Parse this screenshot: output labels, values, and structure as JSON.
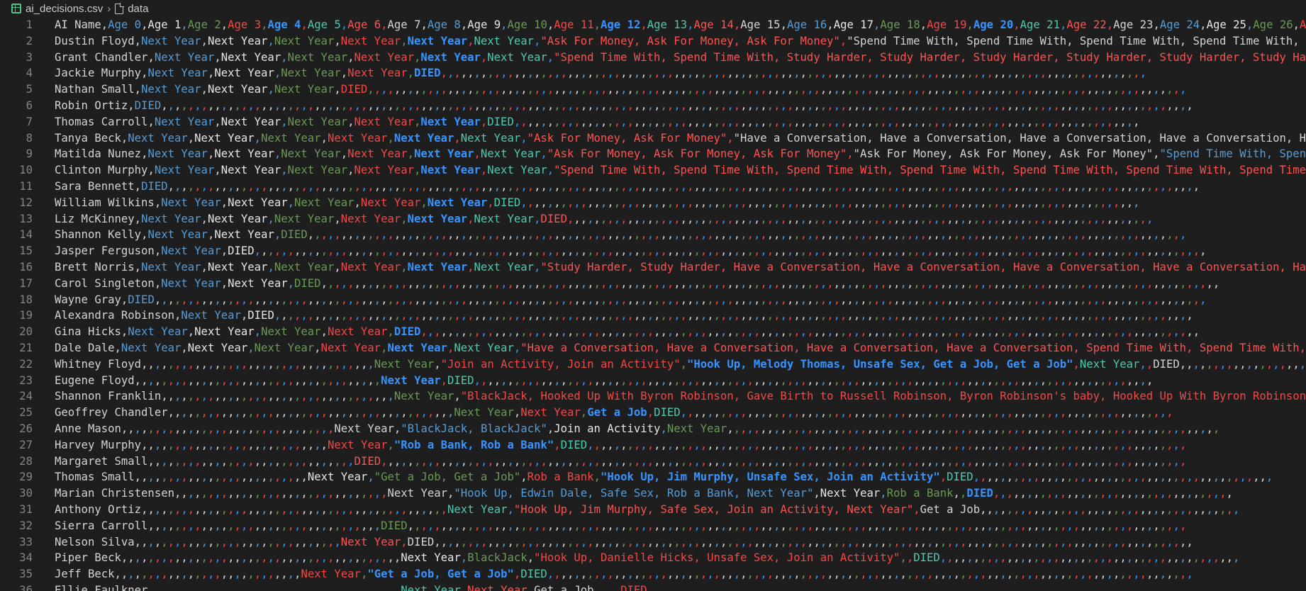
{
  "breadcrumb": {
    "file": "ai_decisions.csv",
    "section": "data"
  },
  "lines": [
    {
      "n": "1",
      "text": "AI Name,Age 0,Age 1,Age 2,Age 3,Age 4,Age 5,Age 6,Age 7,Age 8,Age 9,Age 10,Age 11,Age 12,Age 13,Age 14,Age 15,Age 16,Age 17,Age 18,Age 19,Age 20,Age 21,Age 22,Age 23,Age 24,Age 25,Age 26,Age"
    },
    {
      "n": "2",
      "text": "Dustin Floyd,Next Year,Next Year,Next Year,Next Year,Next Year,Next Year,\"Ask For Money, Ask For Money, Ask For Money\",\"Spend Time With, Spend Time With, Spend Time With, Spend Time With, Spe"
    },
    {
      "n": "3",
      "text": "Grant Chandler,Next Year,Next Year,Next Year,Next Year,Next Year,Next Year,\"Spend Time With, Spend Time With, Study Harder, Study Harder, Study Harder, Study Harder, Study Harder, Study Harde"
    },
    {
      "n": "4",
      "text": "Jackie Murphy,Next Year,Next Year,Next Year,Next Year,DIED,,,,,,,,,,,,,,,,,,,,,,,,,,,,,,,,,,,,,,,,,,,,,,,,,,,,,,,,,,,,,,,,,,,,,,,,,,,,,,,,,,,,,,,,,,,,,,,,,,,,,,,,,,"
    },
    {
      "n": "5",
      "text": "Nathan Small,Next Year,Next Year,Next Year,DIED,,,,,,,,,,,,,,,,,,,,,,,,,,,,,,,,,,,,,,,,,,,,,,,,,,,,,,,,,,,,,,,,,,,,,,,,,,,,,,,,,,,,,,,,,,,,,,,,,,,,,,,,,,,,,,,,,,,,,,,,,,,"
    },
    {
      "n": "6",
      "text": "Robin Ortiz,DIED,,,,,,,,,,,,,,,,,,,,,,,,,,,,,,,,,,,,,,,,,,,,,,,,,,,,,,,,,,,,,,,,,,,,,,,,,,,,,,,,,,,,,,,,,,,,,,,,,,,,,,,,,,,,,,,,,,,,,,,,,,,,,,,,,,,,,,,,,,,,,,,,,,,,,,,,,,,"
    },
    {
      "n": "7",
      "text": "Thomas Carroll,Next Year,Next Year,Next Year,Next Year,Next Year,DIED,,,,,,,,,,,,,,,,,,,,,,,,,,,,,,,,,,,,,,,,,,,,,,,,,,,,,,,,,,,,,,,,,,,,,,,,,,,,,,,,,,,,,,,,,,,,,,"
    },
    {
      "n": "8",
      "text": "Tanya Beck,Next Year,Next Year,Next Year,Next Year,Next Year,Next Year,\"Ask For Money, Ask For Money\",\"Have a Conversation, Have a Conversation, Have a Conversation, Have a Conversation, Have"
    },
    {
      "n": "9",
      "text": "Matilda Nunez,Next Year,Next Year,Next Year,Next Year,Next Year,Next Year,\"Ask For Money, Ask For Money, Ask For Money\",\"Ask For Money, Ask For Money, Ask For Money\",\"Spend Time With, Spend T"
    },
    {
      "n": "10",
      "text": "Clinton Murphy,Next Year,Next Year,Next Year,Next Year,Next Year,Next Year,\"Spend Time With, Spend Time With, Spend Time With, Spend Time With, Spend Time With, Spend Time With, Spend Time Wit"
    },
    {
      "n": "11",
      "text": "Sara Bennett,DIED,,,,,,,,,,,,,,,,,,,,,,,,,,,,,,,,,,,,,,,,,,,,,,,,,,,,,,,,,,,,,,,,,,,,,,,,,,,,,,,,,,,,,,,,,,,,,,,,,,,,,,,,,,,,,,,,,,,,,,,,,,,,,,,,,,,,,,,,,,,,,,,,,,,,,,,,,,,"
    },
    {
      "n": "12",
      "text": "William Wilkins,Next Year,Next Year,Next Year,Next Year,Next Year,DIED,,,,,,,,,,,,,,,,,,,,,,,,,,,,,,,,,,,,,,,,,,,,,,,,,,,,,,,,,,,,,,,,,,,,,,,,,,,,,,,,,,,,,,,,,,,,,"
    },
    {
      "n": "13",
      "text": "Liz McKinney,Next Year,Next Year,Next Year,Next Year,Next Year,Next Year,DIED,,,,,,,,,,,,,,,,,,,,,,,,,,,,,,,,,,,,,,,,,,,,,,,,,,,,,,,,,,,,,,,,,,,,,,,,,,,,,,,,,,,,,,,,"
    },
    {
      "n": "14",
      "text": "Shannon Kelly,Next Year,Next Year,DIED,,,,,,,,,,,,,,,,,,,,,,,,,,,,,,,,,,,,,,,,,,,,,,,,,,,,,,,,,,,,,,,,,,,,,,,,,,,,,,,,,,,,,,,,,,,,,,,,,,,,,,,,,,,,,,,,,,,,,,,,,,,,,,,,,,,,"
    },
    {
      "n": "15",
      "text": "Jasper Ferguson,Next Year,DIED,,,,,,,,,,,,,,,,,,,,,,,,,,,,,,,,,,,,,,,,,,,,,,,,,,,,,,,,,,,,,,,,,,,,,,,,,,,,,,,,,,,,,,,,,,,,,,,,,,,,,,,,,,,,,,,,,,,,,,,,,,,,,,,,,,,,,,,,,,,,,,,"
    },
    {
      "n": "16",
      "text": "Brett Norris,Next Year,Next Year,Next Year,Next Year,Next Year,Next Year,\"Study Harder, Study Harder, Have a Conversation, Have a Conversation, Have a Conversation, Have a Conversation, Have"
    },
    {
      "n": "17",
      "text": "Carol Singleton,Next Year,Next Year,DIED,,,,,,,,,,,,,,,,,,,,,,,,,,,,,,,,,,,,,,,,,,,,,,,,,,,,,,,,,,,,,,,,,,,,,,,,,,,,,,,,,,,,,,,,,,,,,,,,,,,,,,,,,,,,,,,,,,,,,,,,,,,,,,,,,,,,,,,"
    },
    {
      "n": "18",
      "text": "Wayne Gray,DIED,,,,,,,,,,,,,,,,,,,,,,,,,,,,,,,,,,,,,,,,,,,,,,,,,,,,,,,,,,,,,,,,,,,,,,,,,,,,,,,,,,,,,,,,,,,,,,,,,,,,,,,,,,,,,,,,,,,,,,,,,,,,,,,,,,,,,,,,,,,,,,,,,,,,,,,,,,,,,,"
    },
    {
      "n": "19",
      "text": "Alexandra Robinson,Next Year,DIED,,,,,,,,,,,,,,,,,,,,,,,,,,,,,,,,,,,,,,,,,,,,,,,,,,,,,,,,,,,,,,,,,,,,,,,,,,,,,,,,,,,,,,,,,,,,,,,,,,,,,,,,,,,,,,,,,,,,,,,,,,,,,,,,,,,,,,,,,,"
    },
    {
      "n": "20",
      "text": "Gina Hicks,Next Year,Next Year,Next Year,Next Year,DIED,,,,,,,,,,,,,,,,,,,,,,,,,,,,,,,,,,,,,,,,,,,,,,,,,,,,,,,,,,,,,,,,,,,,,,,,,,,,,,,,,,,,,,,,,,,,,,,,,,,,,,,,,,,,,,,,,,,,,"
    },
    {
      "n": "21",
      "text": "Dale Dale,Next Year,Next Year,Next Year,Next Year,Next Year,Next Year,\"Have a Conversation, Have a Conversation, Have a Conversation, Have a Conversation, Spend Time With, Spend Time With, Sp"
    },
    {
      "n": "22",
      "text": "Whitney Floyd,,,,,,,,,,,,,,,,,,,,,,,,,,,,,,,,,,,Next Year,\"Join an Activity, Join an Activity\",\"Hook Up, Melody Thomas, Unsafe Sex, Get a Job, Get a Job\",Next Year,,DIED,,,,,,,,,,,,,,,,,,,,,,,,,"
    },
    {
      "n": "23",
      "text": "Eugene Floyd,,,,,,,,,,,,,,,,,,,,,,,,,,,,,,,,,,,,,Next Year,DIED,,,,,,,,,,,,,,,,,,,,,,,,,,,,,,,,,,,,,,,,,,,,,,,,,,,,,,,,,,,,,,,,,,,,,,,,,,,,,,,,,,,,,,,,,,,,,,,,,,,,,,"
    },
    {
      "n": "24",
      "text": "Shannon Franklin,,,,,,,,,,,,,,,,,,,,,,,,,,,,,,,,,,,Next Year,\"BlackJack, Hooked Up With Byron Robinson, Gave Birth to Russell Robinson, Byron Robinson's baby, Hooked Up With Byron Robinson\",DI"
    },
    {
      "n": "25",
      "text": "Geoffrey Chandler,,,,,,,,,,,,,,,,,,,,,,,,,,,,,,,,,,,,,,,,,,,Next Year,Next Year,Get a Job,DIED,,,,,,,,,,,,,,,,,,,,,,,,,,,,,,,,,,,,,,,,,,,,,,,,,,,,,,,,,,,,,,,,,,,,,,,,,,"
    },
    {
      "n": "26",
      "text": "Anne Mason,,,,,,,,,,,,,,,,,,,,,,,,,,,,,,,,Next Year,\"BlackJack, BlackJack\",Join an Activity,Next Year,,,,,,,,,,,,,,,,,,,,,,,,,,,,,,,,,,,,,,,,,,,,,,,,,,,,,,,,,,,,,,,,,,,,,,,,,,"
    },
    {
      "n": "27",
      "text": "Harvey Murphy,,,,,,,,,,,,,,,,,,,,,,,,,,,,Next Year,\"Rob a Bank, Rob a Bank\",DIED,,,,,,,,,,,,,,,,,,,,,,,,,,,,,,,,,,,,,,,,,,,,,,,,,,,,,,,,,,,,,,,,,,,,,,,,,,,,,,,,,,,,,,,,,,"
    },
    {
      "n": "28",
      "text": "Margaret Small,,,,,,,,,,,,,,,,,,,,,,,,,,,,,,,DIED,,,,,,,,,,,,,,,,,,,,,,,,,,,,,,,,,,,,,,,,,,,,,,,,,,,,,,,,,,,,,,,,,,,,,,,,,,,,,,,,,,,,,,,,,,,,,,,,,,,,,,,,,,,,,,,,,,,,,,,,,"
    },
    {
      "n": "29",
      "text": "Thomas Small,,,,,,,,,,,,,,,,,,,,,,,,,,Next Year,\"Get a Job, Get a Job\",Rob a Bank,\"Hook Up, Jim Murphy, Unsafe Sex, Join an Activity\",DIED,,,,,,,,,,,,,,,,,,,,,,,,,,,,,,,,,,,,,,,,,,,,,"
    },
    {
      "n": "30",
      "text": "Marian Christensen,,,,,,,,,,,,,,,,,,,,,,,,,,,,,,,,Next Year,\"Hook Up, Edwin Dale, Safe Sex, Rob a Bank, Next Year\",Next Year,Rob a Bank,,DIED,,,,,,,,,,,,,,,,,,,,,,,,,,,,,,,,,,,,"
    },
    {
      "n": "31",
      "text": "Anthony Ortiz,,,,,,,,,,,,,,,,,,,,,,,,,,,,,,,,,,,,,,,,,,,,,,Next Year,\"Hook Up, Jim Murphy, Safe Sex, Join an Activity, Next Year\",Get a Job,,,,,,,,,,,,,,,,,,,,,,,,,,,,,,,,,,,,,,,"
    },
    {
      "n": "32",
      "text": "Sierra Carroll,,,,,,,,,,,,,,,,,,,,,,,,,,,,,,,,,,,DIED,,,,,,,,,,,,,,,,,,,,,,,,,,,,,,,,,,,,,,,,,,,,,,,,,,,,,,,,,,,,,,,,,,,,,,,,,,,,,,,,,,,,,,,,,,,,,,,,,,,,,,,,,,,,,,,,,,,,,"
    },
    {
      "n": "33",
      "text": "Nelson Silva,,,,,,,,,,,,,,,,,,,,,,,,,,,,,,,Next Year,DIED,,,,,,,,,,,,,,,,,,,,,,,,,,,,,,,,,,,,,,,,,,,,,,,,,,,,,,,,,,,,,,,,,,,,,,,,,,,,,,,,,,,,,,,,,,,,,,,,,,,,,,,,,,,,,,,,,,"
    },
    {
      "n": "34",
      "text": "Piper Beck,,,,,,,,,,,,,,,,,,,,,,,,,,,,,,,,,,,,,,,,,,Next Year,BlackJack,\"Hook Up, Danielle Hicks, Unsafe Sex, Join an Activity\",,DIED,,,,,,,,,,,,,,,,,,,,,,,,,,,,,,,,,,,,,,,,,,,,,"
    },
    {
      "n": "35",
      "text": "Jeff Beck,,,,,,,,,,,,,,,,,,,,,,,,,,,,Next Year,\"Get a Job, Get a Job\",DIED,,,,,,,,,,,,,,,,,,,,,,,,,,,,,,,,,,,,,,,,,,,,,,,,,,,,,,,,,,,,,,,,,,,,,,,,,,,,,,,,,,,,,,,,,,,,,,,,,"
    },
    {
      "n": "36",
      "text": "Ellie Faulkner,,,,,,,,,,,,,,,,,,,,,,,,,,,,,,,,,,,,,,Next Year,Next Year,Get a Job,,,,DIED,,,,,,,,,,,,,,,,,,,,,,,,,,,,,,,,,,,,,,,,,,,,,,,,,,,,,,,,,,,,,,,,,,,,,,,,,,,,,"
    }
  ]
}
